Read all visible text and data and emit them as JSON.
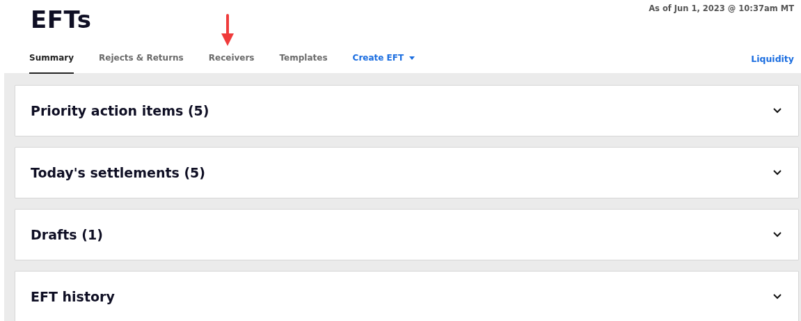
{
  "page": {
    "title": "EFTs",
    "timestamp": "As of Jun 1, 2023 @ 10:37am MT"
  },
  "tabs": [
    {
      "label": "Summary",
      "kind": "tab",
      "selected": true
    },
    {
      "label": "Rejects & Returns",
      "kind": "tab",
      "selected": false
    },
    {
      "label": "Receivers",
      "kind": "tab",
      "selected": false
    },
    {
      "label": "Templates",
      "kind": "tab",
      "selected": false
    },
    {
      "label": "Create EFT",
      "kind": "dropdown",
      "selected": false
    }
  ],
  "side_link": "Liquidity",
  "sections": [
    {
      "title": "Priority action items (5)",
      "expanded": false
    },
    {
      "title": "Today's settlements (5)",
      "expanded": false
    },
    {
      "title": "Drafts (1)",
      "expanded": false
    },
    {
      "title": "EFT history",
      "expanded": false
    }
  ]
}
